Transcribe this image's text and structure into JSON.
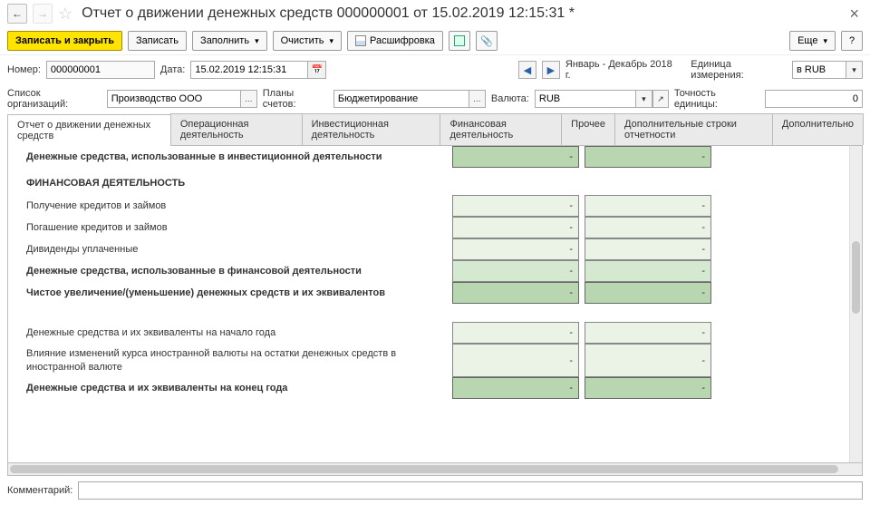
{
  "header": {
    "title": "Отчет о движении денежных средств 000000001 от 15.02.2019 12:15:31 *"
  },
  "toolbar": {
    "save_close": "Записать и закрыть",
    "save": "Записать",
    "fill": "Заполнить",
    "clear": "Очистить",
    "decode": "Расшифровка",
    "more": "Еще",
    "help": "?"
  },
  "fields": {
    "number_label": "Номер:",
    "number": "000000001",
    "date_label": "Дата:",
    "date": "15.02.2019 12:15:31",
    "period": "Январь - Декабрь 2018 г.",
    "unit_label": "Единица измерения:",
    "unit": "в RUB",
    "orgs_label": "Список организаций:",
    "orgs": "Производство ООО",
    "plans_label": "Планы счетов:",
    "plans": "Бюджетирование",
    "currency_label": "Валюта:",
    "currency": "RUB",
    "precision_label": "Точность единицы:",
    "precision": "0",
    "comment_label": "Комментарий:",
    "comment": ""
  },
  "tabs": [
    "Отчет о движении денежных средств",
    "Операционная деятельность",
    "Инвестиционная деятельность",
    "Финансовая деятельность",
    "Прочее",
    "Дополнительные строки отчетности",
    "Дополнительно"
  ],
  "rows": [
    {
      "label": "Денежные средства, использованные в инвестиционной деятельности",
      "bold": true,
      "c1": "-",
      "c2": "-",
      "style": "dark"
    },
    {
      "label": "ФИНАНСОВАЯ ДЕЯТЕЛЬНОСТЬ",
      "section": true
    },
    {
      "label": "Получение кредитов и займов",
      "c1": "-",
      "c2": "-",
      "style": "light"
    },
    {
      "label": "Погашение кредитов и займов",
      "c1": "-",
      "c2": "-",
      "style": "light"
    },
    {
      "label": "Дивиденды уплаченные",
      "c1": "-",
      "c2": "-",
      "style": "light"
    },
    {
      "label": "Денежные средства, использованные в финансовой деятельности",
      "bold": true,
      "c1": "-",
      "c2": "-",
      "style": "mid"
    },
    {
      "label": "Чистое увеличение/(уменьшение) денежных средств и их эквивалентов",
      "bold": true,
      "c1": "-",
      "c2": "-",
      "style": "dark"
    },
    {
      "gap": true
    },
    {
      "label": "Денежные средства и их эквиваленты на начало года",
      "c1": "-",
      "c2": "-",
      "style": "light"
    },
    {
      "label": "Влияние изменений курса иностранной валюты на остатки денежных средств в иностранной валюте",
      "c1": "-",
      "c2": "-",
      "style": "light"
    },
    {
      "label": "Денежные средства и их эквиваленты на конец года",
      "bold": true,
      "c1": "-",
      "c2": "-",
      "style": "dark"
    }
  ]
}
